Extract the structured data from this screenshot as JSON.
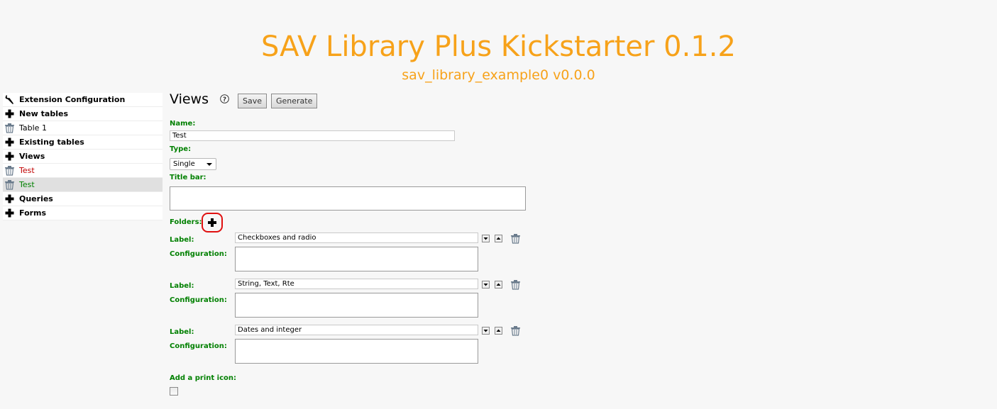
{
  "header": {
    "title": "SAV Library Plus Kickstarter 0.1.2",
    "subtitle": "sav_library_example0 v0.0.0"
  },
  "sidebar": {
    "items": [
      {
        "label": "Extension Configuration",
        "icon": "wrench-icon"
      },
      {
        "label": "New tables",
        "icon": "plus-icon"
      },
      {
        "label": "Table 1",
        "icon": "trash-icon"
      },
      {
        "label": "Existing tables",
        "icon": "plus-icon"
      },
      {
        "label": "Views",
        "icon": "plus-icon"
      },
      {
        "label": "Test",
        "icon": "trash-icon"
      },
      {
        "label": "Test",
        "icon": "trash-icon"
      },
      {
        "label": "Queries",
        "icon": "plus-icon"
      },
      {
        "label": "Forms",
        "icon": "plus-icon"
      }
    ]
  },
  "main": {
    "title": "Views",
    "save_label": "Save",
    "generate_label": "Generate",
    "name_label": "Name:",
    "name_value": "Test",
    "type_label": "Type:",
    "type_value": "Single",
    "title_bar_label": "Title bar:",
    "folders_label": "Folders:",
    "folders": [
      {
        "label_caption": "Label:",
        "label_value": "Checkboxes and radio",
        "config_caption": "Configuration:"
      },
      {
        "label_caption": "Label:",
        "label_value": "String, Text, Rte",
        "config_caption": "Configuration:"
      },
      {
        "label_caption": "Label:",
        "label_value": "Dates and integer",
        "config_caption": "Configuration:"
      }
    ],
    "print_icon_label": "Add a print icon:"
  },
  "colors": {
    "accent": "#f7a21a",
    "label_green": "#008000",
    "highlight_red": "#e01010"
  }
}
